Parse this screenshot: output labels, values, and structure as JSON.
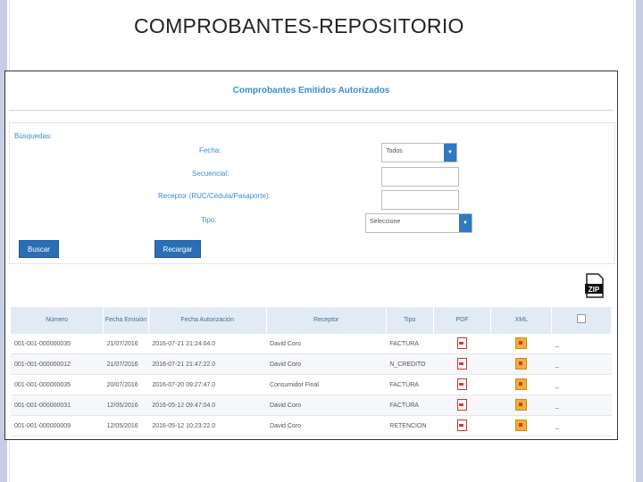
{
  "slide": {
    "title": "COMPROBANTES-REPOSITORIO"
  },
  "app": {
    "title": "Comprobantes Emitidos Autorizados",
    "search": {
      "section_label": "Búsquedas:",
      "fecha_label": "Fecha:",
      "fecha_value": "Todos",
      "secuencial_label": "Secuencial:",
      "receptor_label": "Receptor (RUC/Cédula/Pasaporte):",
      "tipo_label": "Tipo:",
      "tipo_value": "Seleccione",
      "buscar_label": "Buscar",
      "recargar_label": "Recargar"
    },
    "zip_icon_text": "ZIP",
    "table": {
      "headers": [
        "Número",
        "Fecha Emisión",
        "Fecha Autorización",
        "Receptor",
        "Tipo",
        "PDF",
        "XML"
      ],
      "rows": [
        {
          "numero": "001-001-000000035",
          "emision": "21/07/2016",
          "autorizacion": "2016-07-21 21:24:04.0",
          "receptor": "David Coro",
          "tipo": "FACTURA",
          "mark": "_"
        },
        {
          "numero": "001-001-000000012",
          "emision": "21/07/2016",
          "autorizacion": "2016-07-21 21:47:22.0",
          "receptor": "David Coro",
          "tipo": "N_CREDITO",
          "mark": "_"
        },
        {
          "numero": "001-001-000000035",
          "emision": "20/07/2016",
          "autorizacion": "2016-07-20 09:27:47.0",
          "receptor": "Consumidor Final",
          "tipo": "FACTURA",
          "mark": "_"
        },
        {
          "numero": "001-001-000000031",
          "emision": "12/05/2016",
          "autorizacion": "2016-05-12 09:47:04.0",
          "receptor": "David Coro",
          "tipo": "FACTURA",
          "mark": "_"
        },
        {
          "numero": "001-001-000000009",
          "emision": "12/05/2016",
          "autorizacion": "2016-05-12 10:23:22.0",
          "receptor": "David Coro",
          "tipo": "RETENCION",
          "mark": "_"
        }
      ]
    }
  }
}
